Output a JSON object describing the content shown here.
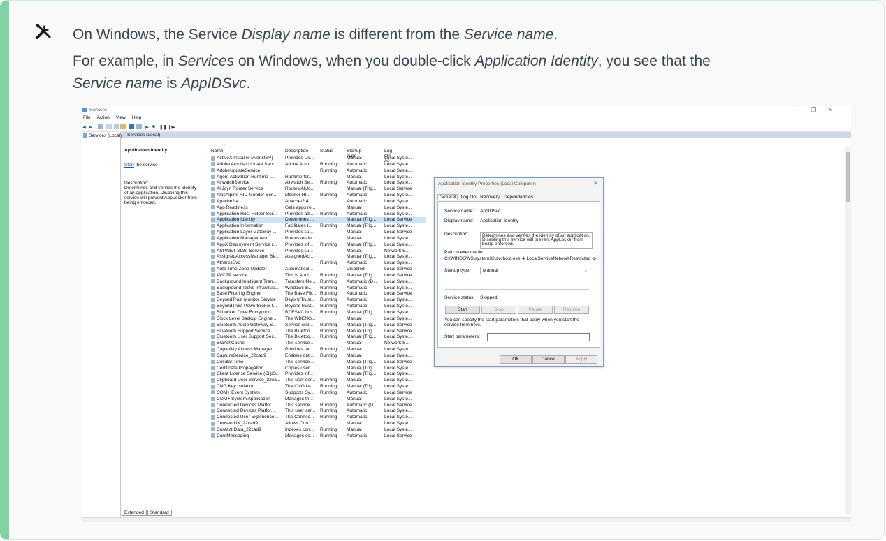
{
  "note": {
    "icon": "tools-icon",
    "line1": {
      "prefix": "On Windows, the Service ",
      "em1": "Display name",
      "middle": " is different from the ",
      "em2": "Service name",
      "suffix": "."
    },
    "line2": {
      "prefix": "For example, in ",
      "em1": "Services",
      "middle": " on Windows, when you double-click ",
      "em2": "Application Identity",
      "middle2": ", you see that the ",
      "em3": "Service name",
      "middle3": " is ",
      "em4": "AppIDSvc",
      "suffix": "."
    }
  },
  "window": {
    "title": "Services",
    "menu": [
      "File",
      "Action",
      "View",
      "Help"
    ],
    "tree_node": "Services (Local)",
    "header": "Services (Local)",
    "details": {
      "heading": "Application Identity",
      "start_link": "Start",
      "start_rest": " the service",
      "description": "Description:\nDetermines and verifies the identity of an application. Disabling this service will prevent AppLocker from being enforced."
    },
    "columns": [
      "Name",
      "Description",
      "Status",
      "Startup Type",
      "Log On As"
    ],
    "rows": [
      [
        "ActiveX Installer (AxInstSV)",
        "Provides Us...",
        "",
        "Manual",
        "Local Syste..."
      ],
      [
        "Adobe Acrobat Update Serv...",
        "Adobe Acro...",
        "Running",
        "Automatic",
        "Local Syste..."
      ],
      [
        "AdobeUpdateService",
        "",
        "Running",
        "Automatic",
        "Local Syste..."
      ],
      [
        "Agent Activation Runtime_...",
        "Runtime for...",
        "",
        "Manual",
        "Local Syste..."
      ],
      [
        "AirwatchService",
        "Airwatch Se...",
        "Running",
        "Automatic",
        "Local Syste..."
      ],
      [
        "AllJoyn Router Service",
        "Routes AllJo...",
        "",
        "Manual (Trig...",
        "Local Service"
      ],
      [
        "AlpsAlpine HID Monitor Ser...",
        "Monitor HI...",
        "Running",
        "Automatic",
        "Local Syste..."
      ],
      [
        "Apache2.4",
        "Apache/2.4....",
        "",
        "Automatic",
        "Local Syste..."
      ],
      [
        "App Readiness",
        "Gets apps re...",
        "",
        "Manual",
        "Local Syste..."
      ],
      [
        "Application Host Helper Ser...",
        "Provides ad...",
        "Running",
        "Automatic",
        "Local Syste..."
      ],
      [
        "Application Identity",
        "Determines ...",
        "",
        "Manual (Trig...",
        "Local Service"
      ],
      [
        "Application Information",
        "Facilitates t...",
        "Running",
        "Manual (Trig...",
        "Local Syste..."
      ],
      [
        "Application Layer Gateway ...",
        "Provides su...",
        "",
        "Manual",
        "Local Service"
      ],
      [
        "Application Management",
        "Processes in...",
        "",
        "Manual",
        "Local Syste..."
      ],
      [
        "AppX Deployment Service (...",
        "Provides inf...",
        "Running",
        "Manual (Trig...",
        "Local Syste..."
      ],
      [
        "ASP.NET State Service",
        "Provides su...",
        "",
        "Manual",
        "Network S..."
      ],
      [
        "AssignedAccessManager Se...",
        "AssignedAc...",
        "",
        "Manual (Trig...",
        "Local Syste..."
      ],
      [
        "AtherosSvc",
        "",
        "Running",
        "Automatic",
        "Local Syste..."
      ],
      [
        "Auto Time Zone Updater",
        "Automatical...",
        "",
        "Disabled",
        "Local Service"
      ],
      [
        "AVCTP service",
        "This is Audi...",
        "Running",
        "Manual (Trig...",
        "Local Service"
      ],
      [
        "Background Intelligent Tran...",
        "Transfers file...",
        "Running",
        "Automatic (D...",
        "Local Syste..."
      ],
      [
        "Background Tasks Infrastruc...",
        "Windows in...",
        "Running",
        "Automatic",
        "Local Syste..."
      ],
      [
        "Base Filtering Engine",
        "The Base Filt...",
        "Running",
        "Automatic",
        "Local Service"
      ],
      [
        "BeyondTrust Monitor Service",
        "BeyondTrust...",
        "Running",
        "Automatic",
        "Local Syste..."
      ],
      [
        "BeyondTrust PowerBroker f...",
        "BeyondTrust...",
        "Running",
        "Automatic",
        "Local Syste..."
      ],
      [
        "BitLocker Drive Encryption ...",
        "BDESVC hos...",
        "Running",
        "Manual (Trig...",
        "Local Syste..."
      ],
      [
        "Block Level Backup Engine ...",
        "The WBENG...",
        "",
        "Manual",
        "Local Syste..."
      ],
      [
        "Bluetooth Audio Gateway S...",
        "Service sup...",
        "Running",
        "Manual (Trig...",
        "Local Service"
      ],
      [
        "Bluetooth Support Service",
        "The Bluetoo...",
        "Running",
        "Manual (Trig...",
        "Local Service"
      ],
      [
        "Bluetooth User Support Ser...",
        "The Bluetoo...",
        "Running",
        "Manual (Trig...",
        "Local Syste..."
      ],
      [
        "BranchCache",
        "This service ...",
        "",
        "Manual",
        "Network S..."
      ],
      [
        "Capability Access Manager ...",
        "Provides fac...",
        "Running",
        "Manual",
        "Local Syste..."
      ],
      [
        "CaptureService_22cad9",
        "Enables opti...",
        "Running",
        "Manual",
        "Local Syste..."
      ],
      [
        "Cellular Time",
        "This service ...",
        "",
        "Manual (Trig...",
        "Local Service"
      ],
      [
        "Certificate Propagation",
        "Copies user ...",
        "",
        "Manual (Trig...",
        "Local Syste..."
      ],
      [
        "Client License Service (ClipS...",
        "Provides inf...",
        "",
        "Manual (Trig...",
        "Local Syste..."
      ],
      [
        "Clipboard User Service_22ca...",
        "This user ser...",
        "Running",
        "Manual",
        "Local Syste..."
      ],
      [
        "CNG Key Isolation",
        "The CNG ke...",
        "Running",
        "Manual (Trig...",
        "Local Syste..."
      ],
      [
        "COM+ Event System",
        "Supports Sy...",
        "Running",
        "Automatic",
        "Local Service"
      ],
      [
        "COM+ System Application",
        "Manages th...",
        "",
        "Manual",
        "Local Syste..."
      ],
      [
        "Connected Devices Platfor...",
        "This service ...",
        "Running",
        "Automatic (D...",
        "Local Service"
      ],
      [
        "Connected Devices Platfor...",
        "This user ser...",
        "Running",
        "Automatic",
        "Local Syste..."
      ],
      [
        "Connected User Experience...",
        "The Connec...",
        "Running",
        "Automatic",
        "Local Syste..."
      ],
      [
        "ConsentUX_22cad9",
        "Allows Con...",
        "",
        "Manual",
        "Local Syste..."
      ],
      [
        "Contact Data_22cad9",
        "Indexes con...",
        "Running",
        "Manual",
        "Local Syste..."
      ],
      [
        "CoreMessaging",
        "Manages co...",
        "Running",
        "Automatic",
        "Local Service"
      ]
    ],
    "bottom_tabs": [
      "Extended",
      "Standard"
    ]
  },
  "dialog": {
    "title": "Application Identity Properties (Local Computer)",
    "tabs": [
      "General",
      "Log On",
      "Recovery",
      "Dependencies"
    ],
    "service_name_label": "Service name:",
    "service_name_value": "AppIDSvc",
    "display_name_label": "Display name:",
    "display_name_value": "Application Identity",
    "description_label": "Description:",
    "description_value": "Determines and verifies the identity of an application. Disabling this service will prevent AppLocker from being enforced.",
    "path_label": "Path to executable:",
    "path_value": "C:\\WINDOWS\\system32\\svchost.exe -k LocalServiceNetworkRestricted -p",
    "startup_type_label": "Startup type:",
    "startup_type_value": "Manual",
    "service_status_label": "Service status:",
    "service_status_value": "Stopped",
    "buttons": {
      "start": "Start",
      "stop": "Stop",
      "pause": "Pause",
      "resume": "Resume"
    },
    "hint": "You can specify the start parameters that apply when you start the service from here.",
    "start_params_label": "Start parameters:",
    "ok": "OK",
    "cancel": "Cancel",
    "apply": "Apply"
  },
  "colors": {
    "accent_bar": "#7fd3a4",
    "selection": "#cce4f7",
    "header": "#cdd9ea"
  }
}
